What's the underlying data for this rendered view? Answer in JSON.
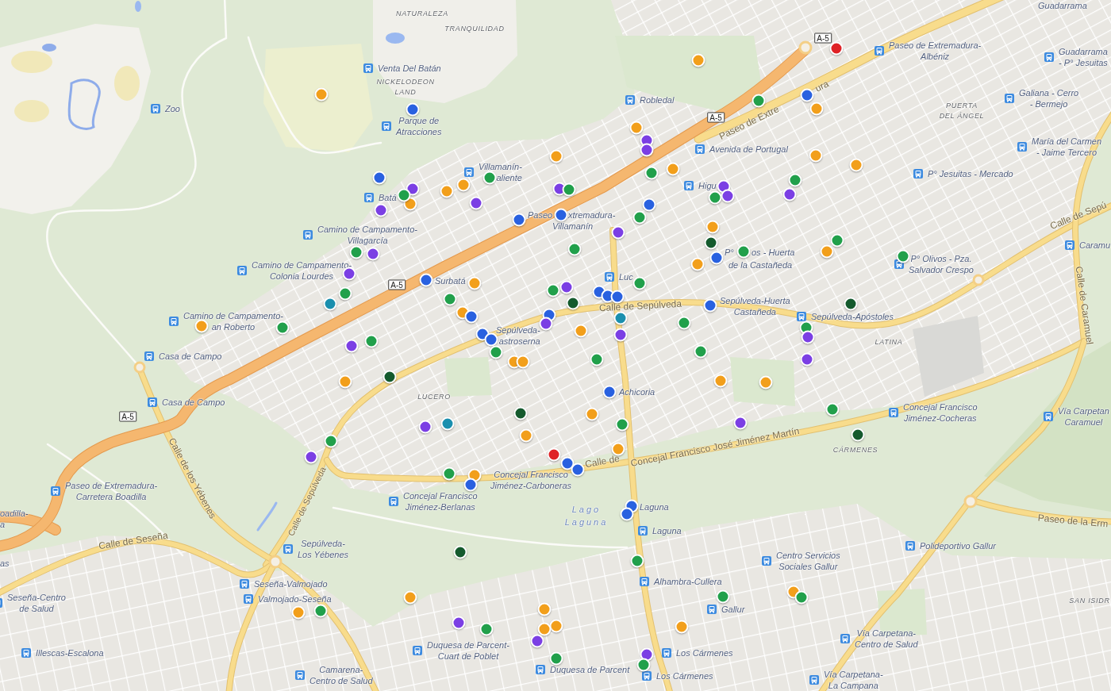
{
  "map": {
    "district_labels": [
      {
        "lines": [
          "NATURALEZA"
        ]
      },
      {
        "lines": [
          "TRANQUILIDAD"
        ]
      },
      {
        "lines": [
          "NICKELODEON",
          "LAND"
        ]
      },
      {
        "lines": [
          "PUERTA",
          "DEL ÁNGEL"
        ]
      },
      {
        "lines": [
          "LATINA"
        ]
      },
      {
        "lines": [
          "LUCERO"
        ]
      },
      {
        "lines": [
          "CÁRMENES"
        ]
      },
      {
        "lines": [
          "SAN ISIDR"
        ]
      }
    ],
    "water_labels": [
      {
        "lines": [
          "Lago",
          "Laguna"
        ]
      }
    ],
    "road_shields": [
      "A-5",
      "A-5",
      "A-5",
      "A-5"
    ],
    "street_labels": [
      "ura",
      "Paseo de Extre",
      "Calle de Sepú",
      "Calle de Sepúlveda",
      "Calle de Caramuel",
      "Calle de los Yébenes",
      "Calle de",
      "Concejal Francisco José Jiménez Martín",
      "Calle de Sepúlveda",
      "Paseo de la Erm",
      "Calle de Seseña"
    ],
    "stops": [
      {
        "kind": "label_only",
        "lines": [
          "Guadarrama"
        ]
      },
      {
        "kind": "bus_stop",
        "lines": [
          "Paseo de Extremadura-",
          "Albéniz"
        ]
      },
      {
        "kind": "bus_stop",
        "lines": [
          "Venta Del Batán"
        ]
      },
      {
        "kind": "bus_stop",
        "lines": [
          "Guadarrama",
          "- P° Jesuitas"
        ]
      },
      {
        "kind": "bus_stop",
        "lines": [
          "Robledal"
        ]
      },
      {
        "kind": "bus_stop",
        "lines": [
          "Zoo"
        ]
      },
      {
        "kind": "bus_stop",
        "lines": [
          "Galiana - Cerro",
          "- Bermejo"
        ]
      },
      {
        "kind": "bus_stop",
        "lines": [
          "Parque de",
          "Atracciones"
        ]
      },
      {
        "kind": "bus_stop",
        "lines": [
          "Avenida de Portugal"
        ]
      },
      {
        "kind": "bus_stop",
        "lines": [
          "María del Carmen",
          "- Jaime Tercero"
        ]
      },
      {
        "kind": "bus_stop",
        "lines": [
          "Villamanín-",
          "aliente"
        ]
      },
      {
        "kind": "bus_stop",
        "lines": [
          "P° Jesuitas - Mercado"
        ]
      },
      {
        "kind": "bus_stop",
        "lines": [
          "Higu"
        ]
      },
      {
        "kind": "bus_stop",
        "lines": [
          "Batá"
        ]
      },
      {
        "kind": "label_only",
        "lines": [
          "Paseo"
        ]
      },
      {
        "kind": "label_only",
        "lines": [
          "xtremadura-"
        ]
      },
      {
        "kind": "bus_stop",
        "lines": [
          "Camino de Campamento-",
          "Villagarcía"
        ]
      },
      {
        "kind": "label_only",
        "lines": [
          "Villamanín"
        ]
      },
      {
        "kind": "bus_stop",
        "lines": [
          "Caramu"
        ]
      },
      {
        "kind": "label_only",
        "lines": [
          "P°"
        ]
      },
      {
        "kind": "label_only",
        "lines": [
          "os - Huerta"
        ]
      },
      {
        "kind": "bus_stop",
        "lines": [
          "Camino de Campamento-",
          "Colonia Lourdes"
        ]
      },
      {
        "kind": "label_only",
        "lines": [
          "de la Castañeda"
        ]
      },
      {
        "kind": "bus_stop",
        "lines": [
          "P° Olivos - Pza.",
          "Salvador Crespo"
        ]
      },
      {
        "kind": "label_only",
        "lines": [
          "Surbatá"
        ]
      },
      {
        "kind": "bus_stop",
        "lines": [
          "Luc"
        ]
      },
      {
        "kind": "label_only",
        "lines": [
          "Sepúlveda-Huerta",
          "Castañeda"
        ]
      },
      {
        "kind": "bus_stop",
        "lines": [
          "Camino de Campamento-",
          "an Roberto"
        ]
      },
      {
        "kind": "bus_stop",
        "lines": [
          "Sepúlveda-Apóstoles"
        ]
      },
      {
        "kind": "label_only",
        "lines": [
          "Sepúlveda-",
          "astroserna"
        ]
      },
      {
        "kind": "bus_stop",
        "lines": [
          "Casa de Campo"
        ]
      },
      {
        "kind": "label_only",
        "lines": [
          "Achicoria"
        ]
      },
      {
        "kind": "bus_stop",
        "lines": [
          "Casa de Campo"
        ]
      },
      {
        "kind": "bus_stop",
        "lines": [
          "Concejal Francisco",
          "Jiménez-Cocheras"
        ]
      },
      {
        "kind": "bus_stop",
        "lines": [
          "Vía Carpetan",
          "Caramuel"
        ]
      },
      {
        "kind": "bus_stop",
        "lines": [
          "Paseo de Extremadura-",
          "Carretera Boadilla"
        ]
      },
      {
        "kind": "label_only",
        "lines": [
          "Concejal Francisco",
          "Jiménez-Carboneras"
        ]
      },
      {
        "kind": "bus_stop",
        "lines": [
          "Concejal Francisco",
          "Jiménez-Berlanas"
        ]
      },
      {
        "kind": "label_only",
        "lines": [
          "Laguna"
        ]
      },
      {
        "kind": "label_only",
        "lines": [
          "oadilla-",
          "a"
        ]
      },
      {
        "kind": "bus_stop",
        "lines": [
          "Laguna"
        ]
      },
      {
        "kind": "bus_stop",
        "lines": [
          "Sepúlveda-",
          "Los Yébenes"
        ]
      },
      {
        "kind": "bus_stop",
        "lines": [
          "Polideportivo Gallur"
        ]
      },
      {
        "kind": "label_only",
        "lines": [
          "as"
        ]
      },
      {
        "kind": "bus_stop",
        "lines": [
          "Centro Servicios",
          "Sociales Gallur"
        ]
      },
      {
        "kind": "bus_stop",
        "lines": [
          "Seseña-Valmojado"
        ]
      },
      {
        "kind": "bus_stop",
        "lines": [
          "Alhambra-Cullera"
        ]
      },
      {
        "kind": "bus_stop",
        "lines": [
          "Seseña-Centro",
          "de Salud"
        ]
      },
      {
        "kind": "bus_stop",
        "lines": [
          "Valmojado-Seseña"
        ]
      },
      {
        "kind": "bus_stop",
        "lines": [
          "Gallur"
        ]
      },
      {
        "kind": "bus_stop",
        "lines": [
          "Vía Carpetana-",
          "Centro de Salud"
        ]
      },
      {
        "kind": "bus_stop",
        "lines": [
          "Illescas-Escalona"
        ]
      },
      {
        "kind": "bus_stop",
        "lines": [
          "Duquesa de Parcent-",
          "Cuart de Poblet"
        ]
      },
      {
        "kind": "bus_stop",
        "lines": [
          "Los Cármenes"
        ]
      },
      {
        "kind": "bus_stop",
        "lines": [
          "Camarena-",
          "Centro de Salud"
        ]
      },
      {
        "kind": "bus_stop",
        "lines": [
          "Duquesa de Parcent"
        ]
      },
      {
        "kind": "bus_stop",
        "lines": [
          "Los Cármenes"
        ]
      },
      {
        "kind": "bus_stop",
        "lines": [
          "Vía Carpetana-",
          "La Campana"
        ]
      }
    ],
    "markers": [
      {
        "color": "#df2226"
      },
      {
        "color": "#f29f1b"
      },
      {
        "color": "#f29f1b"
      },
      {
        "color": "#2961e0"
      },
      {
        "color": "#21a04b"
      },
      {
        "color": "#f29f1b"
      },
      {
        "color": "#2961e0"
      },
      {
        "color": "#f29f1b"
      },
      {
        "color": "#7b3fe4"
      },
      {
        "color": "#7b3fe4"
      },
      {
        "color": "#f29f1b"
      },
      {
        "color": "#f29f1b"
      },
      {
        "color": "#f29f1b"
      },
      {
        "color": "#f29f1b"
      },
      {
        "color": "#21a04b"
      },
      {
        "color": "#21a04b"
      },
      {
        "color": "#2961e0"
      },
      {
        "color": "#21a04b"
      },
      {
        "color": "#f29f1b"
      },
      {
        "color": "#7b3fe4"
      },
      {
        "color": "#7b3fe4"
      },
      {
        "color": "#21a04b"
      },
      {
        "color": "#7b3fe4"
      },
      {
        "color": "#f29f1b"
      },
      {
        "color": "#f29f1b"
      },
      {
        "color": "#21a04b"
      },
      {
        "color": "#7b3fe4"
      },
      {
        "color": "#21a04b"
      },
      {
        "color": "#7b3fe4"
      },
      {
        "color": "#7b3fe4"
      },
      {
        "color": "#2961e0"
      },
      {
        "color": "#7b3fe4"
      },
      {
        "color": "#2961e0"
      },
      {
        "color": "#21a04b"
      },
      {
        "color": "#2961e0"
      },
      {
        "color": "#f29f1b"
      },
      {
        "color": "#7b3fe4"
      },
      {
        "color": "#21a04b"
      },
      {
        "color": "#145a2d"
      },
      {
        "color": "#21a04b"
      },
      {
        "color": "#7b3fe4"
      },
      {
        "color": "#f29f1b"
      },
      {
        "color": "#21a04b"
      },
      {
        "color": "#21a04b"
      },
      {
        "color": "#2961e0"
      },
      {
        "color": "#21a04b"
      },
      {
        "color": "#f29f1b"
      },
      {
        "color": "#7b3fe4"
      },
      {
        "color": "#2961e0"
      },
      {
        "color": "#21a04b"
      },
      {
        "color": "#f29f1b"
      },
      {
        "color": "#7b3fe4"
      },
      {
        "color": "#21a04b"
      },
      {
        "color": "#21a04b"
      },
      {
        "color": "#2961e0"
      },
      {
        "color": "#2961e0"
      },
      {
        "color": "#2961e0"
      },
      {
        "color": "#21a04b"
      },
      {
        "color": "#145a2d"
      },
      {
        "color": "#1a8fae"
      },
      {
        "color": "#145a2d"
      },
      {
        "color": "#2961e0"
      },
      {
        "color": "#f29f1b"
      },
      {
        "color": "#2961e0"
      },
      {
        "color": "#2961e0"
      },
      {
        "color": "#1a8fae"
      },
      {
        "color": "#21a04b"
      },
      {
        "color": "#7b3fe4"
      },
      {
        "color": "#21a04b"
      },
      {
        "color": "#f29f1b"
      },
      {
        "color": "#21a04b"
      },
      {
        "color": "#f29f1b"
      },
      {
        "color": "#7b3fe4"
      },
      {
        "color": "#2961e0"
      },
      {
        "color": "#7b3fe4"
      },
      {
        "color": "#2961e0"
      },
      {
        "color": "#21a04b"
      },
      {
        "color": "#7b3fe4"
      },
      {
        "color": "#21a04b"
      },
      {
        "color": "#21a04b"
      },
      {
        "color": "#7b3fe4"
      },
      {
        "color": "#21a04b"
      },
      {
        "color": "#f29f1b"
      },
      {
        "color": "#f29f1b"
      },
      {
        "color": "#145a2d"
      },
      {
        "color": "#f29f1b"
      },
      {
        "color": "#f29f1b"
      },
      {
        "color": "#f29f1b"
      },
      {
        "color": "#2961e0"
      },
      {
        "color": "#21a04b"
      },
      {
        "color": "#145a2d"
      },
      {
        "color": "#f29f1b"
      },
      {
        "color": "#1a8fae"
      },
      {
        "color": "#21a04b"
      },
      {
        "color": "#7b3fe4"
      },
      {
        "color": "#7b3fe4"
      },
      {
        "color": "#145a2d"
      },
      {
        "color": "#f29f1b"
      },
      {
        "color": "#21a04b"
      },
      {
        "color": "#f29f1b"
      },
      {
        "color": "#df2226"
      },
      {
        "color": "#7b3fe4"
      },
      {
        "color": "#2961e0"
      },
      {
        "color": "#2961e0"
      },
      {
        "color": "#21a04b"
      },
      {
        "color": "#f29f1b"
      },
      {
        "color": "#2961e0"
      },
      {
        "color": "#2961e0"
      },
      {
        "color": "#2961e0"
      },
      {
        "color": "#145a2d"
      },
      {
        "color": "#21a04b"
      },
      {
        "color": "#f29f1b"
      },
      {
        "color": "#21a04b"
      },
      {
        "color": "#f29f1b"
      },
      {
        "color": "#21a04b"
      },
      {
        "color": "#21a04b"
      },
      {
        "color": "#f29f1b"
      },
      {
        "color": "#f29f1b"
      },
      {
        "color": "#7b3fe4"
      },
      {
        "color": "#f29f1b"
      },
      {
        "color": "#f29f1b"
      },
      {
        "color": "#f29f1b"
      },
      {
        "color": "#21a04b"
      },
      {
        "color": "#7b3fe4"
      },
      {
        "color": "#7b3fe4"
      },
      {
        "color": "#21a04b"
      },
      {
        "color": "#21a04b"
      }
    ]
  }
}
